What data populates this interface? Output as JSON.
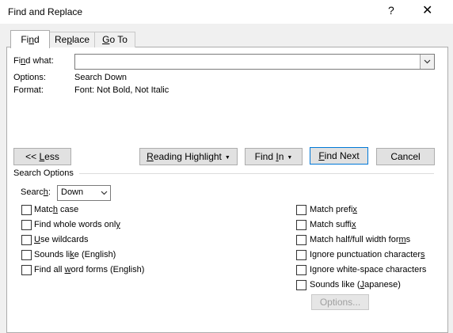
{
  "window": {
    "title": "Find and Replace",
    "help_glyph": "?",
    "close_glyph": "✕"
  },
  "tabs": [
    {
      "label_pre": "Fi",
      "label_u": "n",
      "label_post": "d"
    },
    {
      "label_pre": "Re",
      "label_u": "p",
      "label_post": "lace"
    },
    {
      "label_pre": "",
      "label_u": "G",
      "label_post": "o To"
    }
  ],
  "find": {
    "label_pre": "Fi",
    "label_u": "n",
    "label_post": "d what:",
    "value": ""
  },
  "options": {
    "label": "Options:",
    "value": "Search Down"
  },
  "format": {
    "label": "Format:",
    "value": "Font: Not Bold, Not Italic"
  },
  "buttons": {
    "less": {
      "pre": "<< ",
      "u": "L",
      "post": "ess"
    },
    "reading_highlight": {
      "pre": "",
      "u": "R",
      "post": "eading Highlight"
    },
    "find_in": {
      "pre": "Find ",
      "u": "I",
      "post": "n"
    },
    "find_next": {
      "pre": "",
      "u": "F",
      "post": "ind Next"
    },
    "cancel": {
      "label": "Cancel"
    },
    "options": {
      "label": "Options..."
    }
  },
  "search_options": {
    "heading": "Search Options",
    "search_label_pre": "Searc",
    "search_label_u": "h",
    "search_label_post": ":",
    "search_value": "Down",
    "left": [
      {
        "pre": "Matc",
        "u": "h",
        "post": " case",
        "checked": false
      },
      {
        "pre": "Find whole words onl",
        "u": "y",
        "post": "",
        "checked": false
      },
      {
        "pre": "",
        "u": "U",
        "post": "se wildcards",
        "checked": false
      },
      {
        "pre": "Sounds li",
        "u": "k",
        "post": "e (English)",
        "checked": false
      },
      {
        "pre": "Find all ",
        "u": "w",
        "post": "ord forms (English)",
        "checked": false
      }
    ],
    "right": [
      {
        "pre": "Match prefi",
        "u": "x",
        "post": "",
        "checked": false
      },
      {
        "pre": "Match suffi",
        "u": "x",
        "post": "",
        "checked": false
      },
      {
        "pre": "Match half/full width for",
        "u": "m",
        "post": "s",
        "checked": false
      },
      {
        "pre": "Ignore punctuation character",
        "u": "s",
        "post": "",
        "checked": false
      },
      {
        "pre": "Ignore white-space characters",
        "u": "",
        "post": "",
        "checked": false
      },
      {
        "pre": "Sounds like (",
        "u": "J",
        "post": "apanese)",
        "checked": false
      }
    ]
  }
}
